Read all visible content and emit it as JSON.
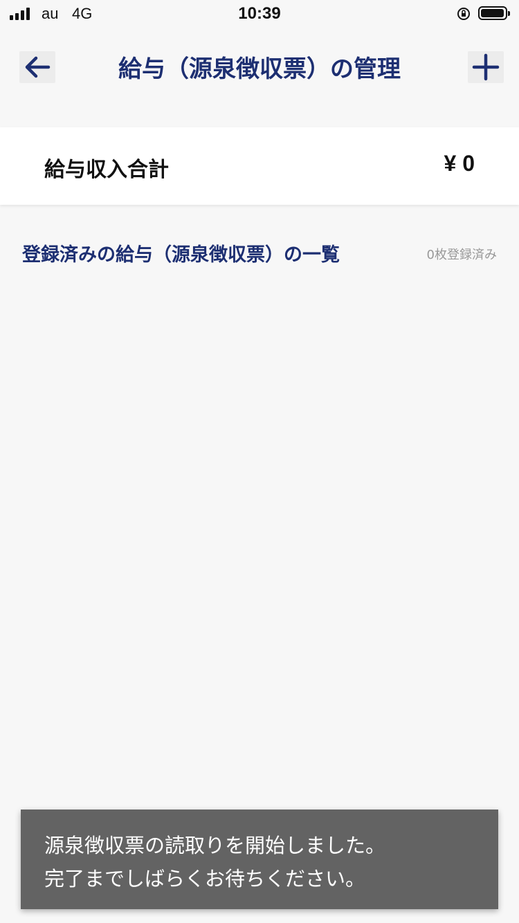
{
  "status_bar": {
    "carrier": "au",
    "network": "4G",
    "time": "10:39"
  },
  "nav": {
    "title": "給与（源泉徴収票）の管理",
    "back_icon": "arrow-left-icon",
    "add_icon": "plus-icon"
  },
  "summary": {
    "label": "給与収入合計",
    "value": "¥ 0"
  },
  "list": {
    "title": "登録済みの給与（源泉徴収票）の一覧",
    "count": "0枚登録済み"
  },
  "toast": {
    "line1": "源泉徴収票の読取りを開始しました。",
    "line2": "完了までしばらくお待ちください。"
  },
  "colors": {
    "accent": "#1d2f72",
    "background": "#f7f7f7",
    "toast_bg": "#636363"
  }
}
